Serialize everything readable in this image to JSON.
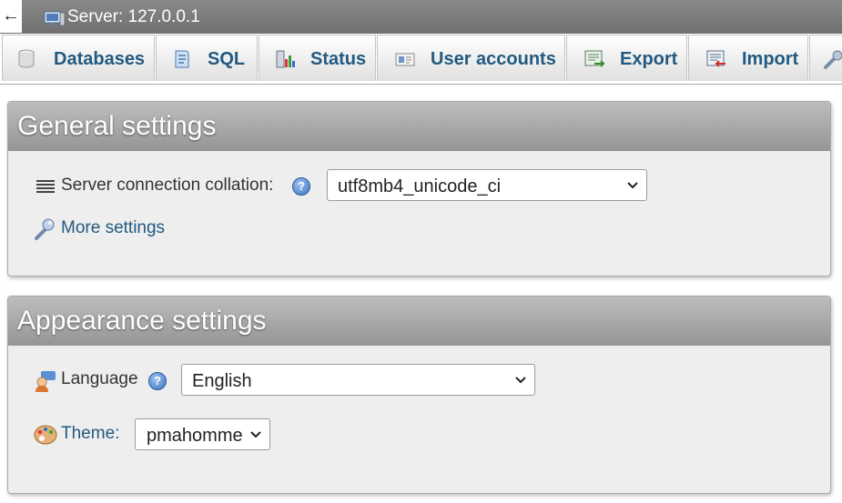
{
  "topbar": {
    "back_glyph": "←",
    "server_title": "Server: 127.0.0.1"
  },
  "tabs": [
    {
      "label": "Databases",
      "icon": "database-icon"
    },
    {
      "label": "SQL",
      "icon": "sql-icon"
    },
    {
      "label": "Status",
      "icon": "status-icon"
    },
    {
      "label": "User accounts",
      "icon": "user-accounts-icon"
    },
    {
      "label": "Export",
      "icon": "export-icon"
    },
    {
      "label": "Import",
      "icon": "import-icon"
    },
    {
      "label": "",
      "icon": "wrench-icon"
    }
  ],
  "general": {
    "title": "General settings",
    "collation_label": "Server connection collation:",
    "collation_value": "utf8mb4_unicode_ci",
    "more_settings": "More settings",
    "help_glyph": "?"
  },
  "appearance": {
    "title": "Appearance settings",
    "language_label": "Language",
    "language_value": "English",
    "theme_label": "Theme:",
    "theme_value": "pmahomme",
    "help_glyph": "?"
  },
  "colors": {
    "link": "#235a81",
    "panel_header": "#a8a8a8",
    "topbar": "#7d7d7d"
  }
}
